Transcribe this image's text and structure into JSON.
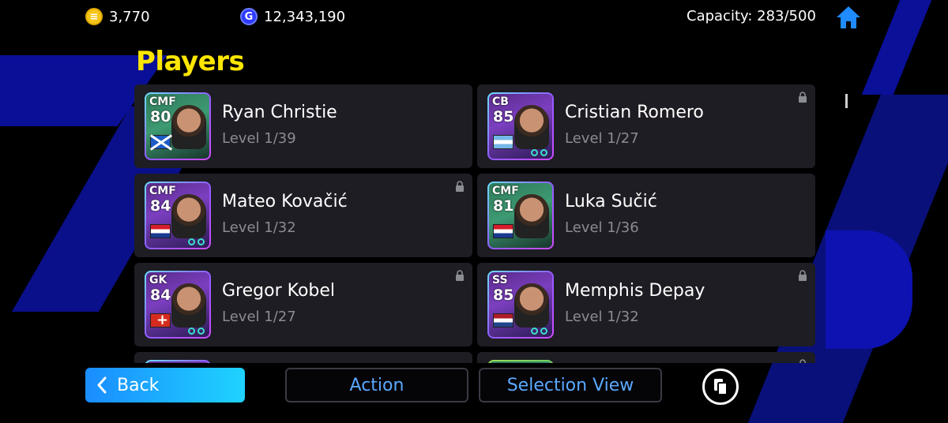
{
  "topbar": {
    "ecoins": "3,770",
    "gp": "12,343,190",
    "capacity": "Capacity: 283/500"
  },
  "section_title": "Players",
  "players": [
    {
      "position": "CMF",
      "rating": "80",
      "name": "Ryan Christie",
      "level": "Level 1/39",
      "flag": "scotland",
      "locked": false
    },
    {
      "position": "CB",
      "rating": "85",
      "name": "Cristian Romero",
      "level": "Level 1/27",
      "flag": "argentina",
      "locked": true
    },
    {
      "position": "CMF",
      "rating": "84",
      "name": "Mateo Kovačić",
      "level": "Level 1/32",
      "flag": "croatia",
      "locked": true
    },
    {
      "position": "CMF",
      "rating": "81",
      "name": "Luka Sučić",
      "level": "Level 1/36",
      "flag": "croatia",
      "locked": false
    },
    {
      "position": "GK",
      "rating": "84",
      "name": "Gregor Kobel",
      "level": "Level 1/27",
      "flag": "switzerland",
      "locked": true
    },
    {
      "position": "SS",
      "rating": "85",
      "name": "Memphis Depay",
      "level": "Level 1/32",
      "flag": "netherlands",
      "locked": true
    }
  ],
  "buttons": {
    "back": "Back",
    "action": "Action",
    "selection_view": "Selection View"
  },
  "colors": {
    "title_yellow": "#ffe600",
    "accent_blue": "#5aa8ff",
    "card_bg": "#1d1d23"
  }
}
